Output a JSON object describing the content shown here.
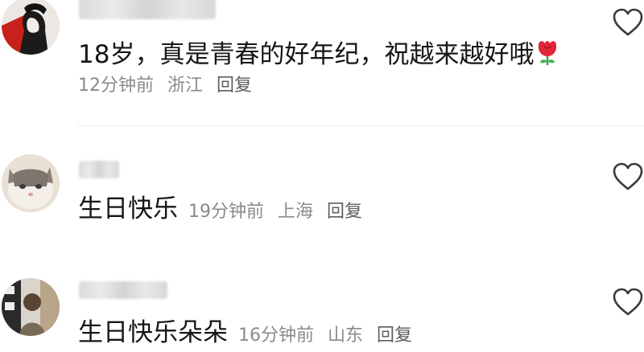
{
  "comments": [
    {
      "text": "18岁，真是青春的好年纪，祝越来越好哦",
      "emoji": "rose-emoji",
      "time": "12分钟前",
      "location": "浙江",
      "reply_label": "回复"
    },
    {
      "text": "生日快乐",
      "time": "19分钟前",
      "location": "上海",
      "reply_label": "回复"
    },
    {
      "text": "生日快乐朵朵",
      "time": "16分钟前",
      "location": "山东",
      "reply_label": "回复"
    }
  ],
  "icons": {
    "like": "heart-outline-icon"
  },
  "colors": {
    "text": "#161616",
    "meta": "#8a8a8a",
    "reply": "#5e5e5e",
    "divider": "#ececec"
  }
}
